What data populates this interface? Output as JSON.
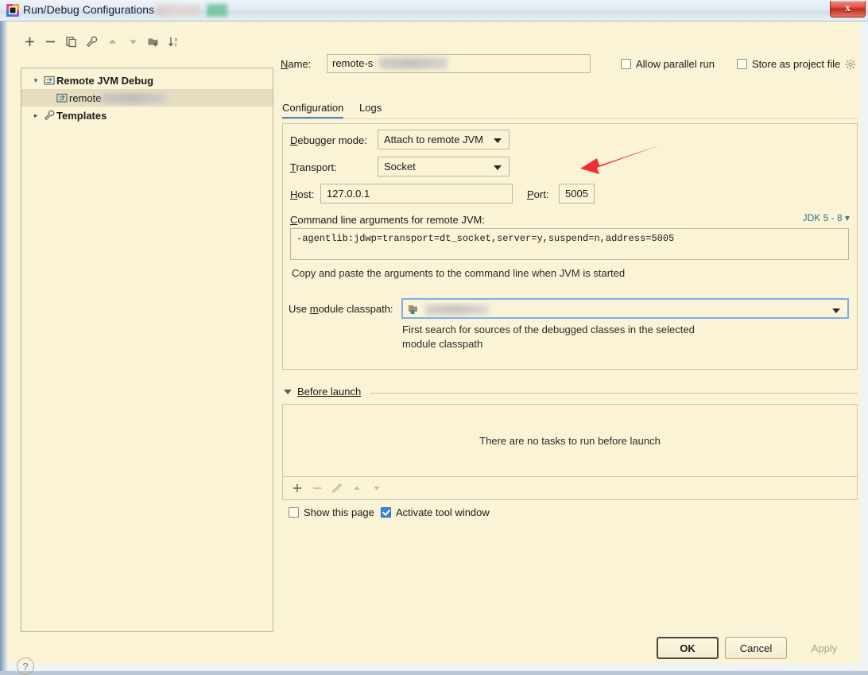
{
  "window": {
    "title": "Run/Debug Configurations",
    "title_icon": "idea-app-icon",
    "close_label": "x"
  },
  "left_panel": {
    "toolbar": [
      {
        "name": "add-configuration-button",
        "icon": "plus-icon"
      },
      {
        "name": "remove-configuration-button",
        "icon": "minus-icon"
      },
      {
        "name": "copy-configuration-button",
        "icon": "copy-icon"
      },
      {
        "name": "edit-templates-button",
        "icon": "wrench-icon"
      },
      {
        "name": "move-up-button",
        "icon": "arrow-up-icon"
      },
      {
        "name": "move-down-button",
        "icon": "arrow-down-icon"
      },
      {
        "name": "move-into-folder-button",
        "icon": "folder-add-icon"
      },
      {
        "name": "sort-configurations-button",
        "icon": "sort-az-icon"
      }
    ],
    "tree": [
      {
        "label": "Remote JVM Debug",
        "icon": "remote-debug-icon",
        "expanded": true,
        "level": 0,
        "bold": true,
        "selected": false
      },
      {
        "label": "remote",
        "icon": "remote-debug-icon",
        "expanded": null,
        "level": 1,
        "bold": false,
        "selected": true,
        "redacted": true
      },
      {
        "label": "Templates",
        "icon": "wrench-icon",
        "expanded": false,
        "level": 0,
        "bold": true,
        "selected": false
      }
    ]
  },
  "header": {
    "name_label": "Name:",
    "name_value": "remote-s",
    "name_redacted": true,
    "allow_parallel_run": {
      "label": "Allow parallel run",
      "checked": false
    },
    "store_as_project_file": {
      "label": "Store as project file",
      "checked": false,
      "icon": "gear-icon"
    }
  },
  "tabs": [
    {
      "label": "Configuration",
      "active": true
    },
    {
      "label": "Logs",
      "active": false
    }
  ],
  "configuration": {
    "debugger_mode": {
      "label": "Debugger mode:",
      "value": "Attach to remote JVM"
    },
    "transport": {
      "label": "Transport:",
      "value": "Socket"
    },
    "host": {
      "label": "Host:",
      "value": "127.0.0.1"
    },
    "port": {
      "label": "Port:",
      "value": "5005"
    },
    "command_line": {
      "label": "Command line arguments for remote JVM:",
      "jdk_selector": "JDK 5 - 8",
      "value": "-agentlib:jdwp=transport=dt_socket,server=y,suspend=n,address=5005",
      "hint": "Copy and paste the arguments to the command line when JVM is started"
    },
    "module_classpath": {
      "label": "Use module classpath:",
      "value": "",
      "redacted": true,
      "icon": "module-icon",
      "hint_line1": "First search for sources of the debugged classes in the selected",
      "hint_line2": "module classpath"
    }
  },
  "before_launch": {
    "title": "Before launch",
    "expanded": true,
    "empty_message": "There are no tasks to run before launch",
    "toolbar": [
      {
        "name": "add-task-button",
        "icon": "plus-icon",
        "enabled": true
      },
      {
        "name": "remove-task-button",
        "icon": "minus-icon",
        "enabled": false
      },
      {
        "name": "edit-task-button",
        "icon": "pencil-icon",
        "enabled": false
      },
      {
        "name": "task-move-up-button",
        "icon": "arrow-up-icon",
        "enabled": false
      },
      {
        "name": "task-move-down-button",
        "icon": "arrow-down-icon",
        "enabled": false
      }
    ],
    "show_this_page": {
      "label": "Show this page",
      "checked": false
    },
    "activate_tool_window": {
      "label": "Activate tool window",
      "checked": true
    }
  },
  "footer": {
    "help_label": "?",
    "ok_label": "OK",
    "cancel_label": "Cancel",
    "apply_label": "Apply",
    "apply_enabled": false
  },
  "annotation": {
    "type": "red-arrow",
    "points_at": "port-input",
    "color": "#f03030"
  },
  "colors": {
    "dialog_background": "#faf3d5",
    "selection": "#e6dcc0",
    "accent_blue": "#4286c9",
    "link_teal": "#2f7c8c",
    "annotation_red": "#f03030"
  }
}
